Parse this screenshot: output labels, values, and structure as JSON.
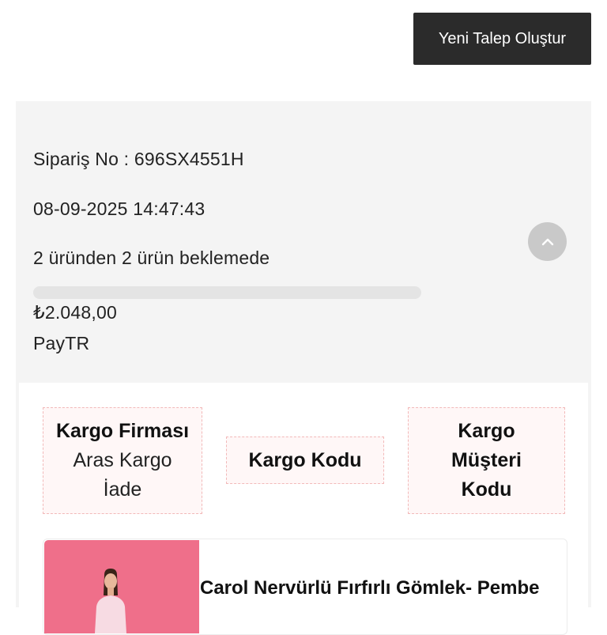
{
  "header": {
    "new_request_label": "Yeni Talep Oluştur"
  },
  "order": {
    "order_no": "Sipariş No : 696SX4551H",
    "datetime": "08-09-2025 14:47:43",
    "status": "2 üründen 2 ürün beklemede",
    "progress": 0,
    "amount": "₺2.048,00",
    "payment_method": "PayTR"
  },
  "cargo": {
    "company_label": "Kargo Firması",
    "company_value": "Aras Kargo İade",
    "code_label": "Kargo Kodu",
    "customer_code_label": "Kargo Müşteri Kodu"
  },
  "product": {
    "name": "Carol Nervürlü Fırfırlı Gömlek- Pembe"
  },
  "icons": {
    "collapse": "chevron-up-icon"
  },
  "colors": {
    "button_dark": "#2b2b2b",
    "card_bg": "#f4f4f4",
    "cargo_border": "#f2b9b9",
    "thumb_bg": "#ef6f8a"
  }
}
